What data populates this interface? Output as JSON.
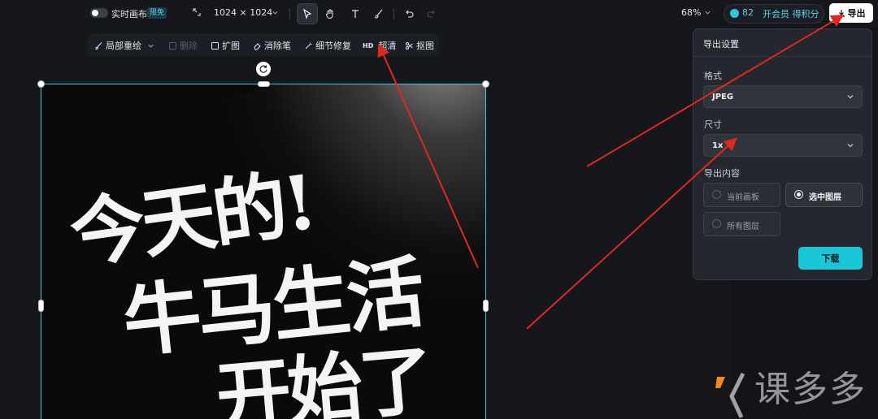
{
  "topbar": {
    "realtime_canvas_label": "实时画布",
    "free_badge": "限免",
    "canvas_size": "1024 × 1024",
    "zoom": "68%",
    "points": "82",
    "vip_label": "开会员 得积分",
    "export_label": "导出"
  },
  "subbar": {
    "items": [
      {
        "label": "局部重绘",
        "icon": "brush-icon"
      },
      {
        "label": "删除",
        "icon": "delete-icon"
      },
      {
        "label": "扩图",
        "icon": "expand-icon"
      },
      {
        "label": "消除笔",
        "icon": "eraser-icon"
      },
      {
        "label": "细节修复",
        "icon": "magic-wand-icon"
      },
      {
        "label": "超清",
        "icon": "hd-icon"
      },
      {
        "label": "抠图",
        "icon": "cutout-icon"
      }
    ],
    "hd_prefix": "HD"
  },
  "poster": {
    "line1": "今天的!",
    "line2": "牛马生活",
    "line3": "开始了"
  },
  "export_panel": {
    "title": "导出设置",
    "format_label": "格式",
    "format_value": "JPEG",
    "size_label": "尺寸",
    "size_value": "1x",
    "content_label": "导出内容",
    "options": [
      {
        "label": "当前画板",
        "selected": false
      },
      {
        "label": "选中图层",
        "selected": true
      },
      {
        "label": "所有图层",
        "selected": false
      }
    ],
    "download_label": "下载"
  },
  "watermark": {
    "text": "课多多"
  },
  "colors": {
    "accent": "#19c7d8",
    "selection": "#3fc7d3",
    "annotation_arrow": "#e0281e",
    "background": "#15171c"
  }
}
